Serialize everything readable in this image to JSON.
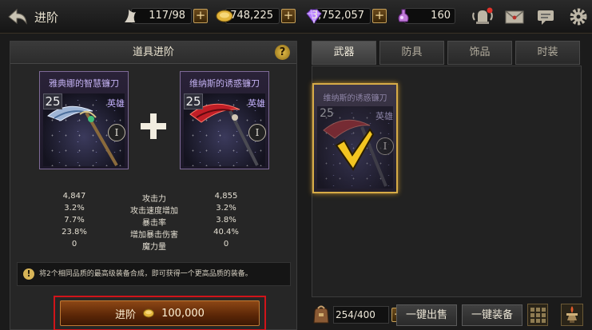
{
  "header": {
    "title": "进阶",
    "stamina": "117/98",
    "gold": "748,225",
    "gems": "3,752,057",
    "potion": "160",
    "plus_label": "+"
  },
  "panel": {
    "title": "道具进阶",
    "help_label": "?",
    "left_item": {
      "name": "雅典娜的智慧镰刀",
      "level": "25",
      "rarity": "英雄",
      "tier": "I"
    },
    "right_item": {
      "name": "维纳斯的诱惑镰刀",
      "level": "25",
      "rarity": "英雄",
      "tier": "I"
    },
    "stats": [
      {
        "left": "4,847",
        "name": "攻击力",
        "right": "4,855"
      },
      {
        "left": "3.2%",
        "name": "攻击速度增加",
        "right": "3.2%"
      },
      {
        "left": "7.7%",
        "name": "暴击率",
        "right": "3.8%"
      },
      {
        "left": "23.8%",
        "name": "增加暴击伤害",
        "right": "40.4%"
      },
      {
        "left": "0",
        "name": "魔力量",
        "right": "0"
      }
    ],
    "notice": "将2个相同品质的最高级装备合成，即可获得一个更高品质的装备。",
    "advance_label": "进阶",
    "advance_cost": "100,000"
  },
  "tabs": [
    "武器",
    "防具",
    "饰品",
    "时装"
  ],
  "inventory": {
    "items": [
      {
        "name": "维纳斯的诱惑镰刀",
        "level": "25",
        "rarity": "英雄",
        "tier": "I"
      }
    ]
  },
  "bottom": {
    "bag_count": "254/400",
    "sell_all_label": "一键出售",
    "equip_all_label": "一键装备"
  },
  "colors": {
    "accent_gold": "#d6ab47",
    "highlight_red": "#d0141a",
    "rarity_purple": "#c2b0f0"
  }
}
